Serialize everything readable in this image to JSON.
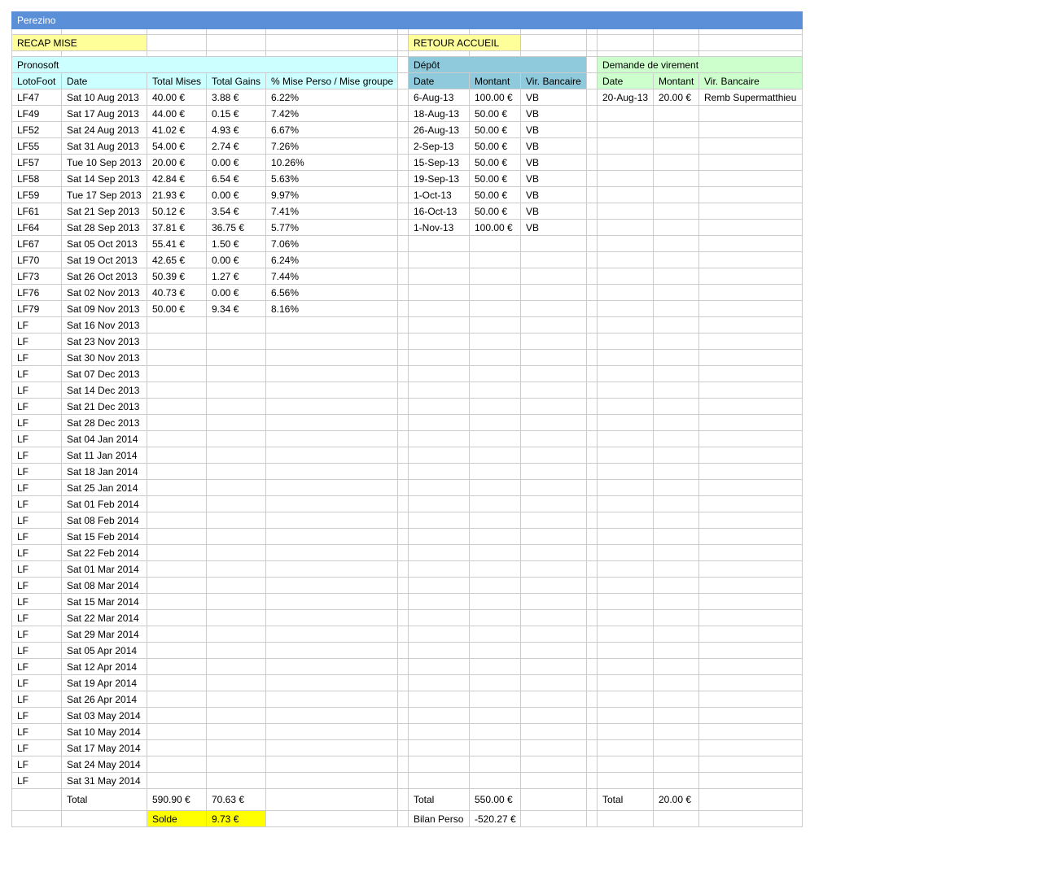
{
  "sheet": {
    "title": "Perezino",
    "recap_label": "RECAP MISE",
    "retour_label": "RETOUR ACCUEIL"
  },
  "pronosoft": {
    "title": "Pronosoft",
    "headers": [
      "LotoFoot",
      "Date",
      "Total Mises",
      "Total Gains",
      "% Mise Perso / Mise groupe"
    ],
    "rows": [
      [
        "LF47",
        "Sat 10 Aug 2013",
        "40.00 €",
        "3.88 €",
        "6.22%"
      ],
      [
        "LF49",
        "Sat 17 Aug 2013",
        "44.00 €",
        "0.15 €",
        "7.42%"
      ],
      [
        "LF52",
        "Sat 24 Aug 2013",
        "41.02 €",
        "4.93 €",
        "6.67%"
      ],
      [
        "LF55",
        "Sat 31 Aug 2013",
        "54.00 €",
        "2.74 €",
        "7.26%"
      ],
      [
        "LF57",
        "Tue 10 Sep 2013",
        "20.00 €",
        "0.00 €",
        "10.26%"
      ],
      [
        "LF58",
        "Sat 14 Sep 2013",
        "42.84 €",
        "6.54 €",
        "5.63%"
      ],
      [
        "LF59",
        "Tue 17 Sep 2013",
        "21.93 €",
        "0.00 €",
        "9.97%"
      ],
      [
        "LF61",
        "Sat 21 Sep 2013",
        "50.12 €",
        "3.54 €",
        "7.41%"
      ],
      [
        "LF64",
        "Sat 28 Sep 2013",
        "37.81 €",
        "36.75 €",
        "5.77%"
      ],
      [
        "LF67",
        "Sat 05 Oct 2013",
        "55.41 €",
        "1.50 €",
        "7.06%"
      ],
      [
        "LF70",
        "Sat 19 Oct 2013",
        "42.65 €",
        "0.00 €",
        "6.24%"
      ],
      [
        "LF73",
        "Sat 26 Oct 2013",
        "50.39 €",
        "1.27 €",
        "7.44%"
      ],
      [
        "LF76",
        "Sat 02 Nov 2013",
        "40.73 €",
        "0.00 €",
        "6.56%"
      ],
      [
        "LF79",
        "Sat 09 Nov 2013",
        "50.00 €",
        "9.34 €",
        "8.16%"
      ],
      [
        "LF",
        "Sat 16 Nov 2013"
      ],
      [
        "LF",
        "Sat 23 Nov 2013"
      ],
      [
        "LF",
        "Sat 30 Nov 2013"
      ],
      [
        "LF",
        "Sat 07 Dec 2013"
      ],
      [
        "LF",
        "Sat 14 Dec 2013"
      ],
      [
        "LF",
        "Sat 21 Dec 2013"
      ],
      [
        "LF",
        "Sat 28 Dec 2013"
      ],
      [
        "LF",
        "Sat 04 Jan 2014"
      ],
      [
        "LF",
        "Sat 11 Jan 2014"
      ],
      [
        "LF",
        "Sat 18 Jan 2014"
      ],
      [
        "LF",
        "Sat 25 Jan 2014"
      ],
      [
        "LF",
        "Sat 01 Feb 2014"
      ],
      [
        "LF",
        "Sat 08 Feb 2014"
      ],
      [
        "LF",
        "Sat 15 Feb 2014"
      ],
      [
        "LF",
        "Sat 22 Feb 2014"
      ],
      [
        "LF",
        "Sat 01 Mar 2014"
      ],
      [
        "LF",
        "Sat 08 Mar 2014"
      ],
      [
        "LF",
        "Sat 15 Mar 2014"
      ],
      [
        "LF",
        "Sat 22 Mar 2014"
      ],
      [
        "LF",
        "Sat 29 Mar 2014"
      ],
      [
        "LF",
        "Sat 05 Apr 2014"
      ],
      [
        "LF",
        "Sat 12 Apr 2014"
      ],
      [
        "LF",
        "Sat 19 Apr 2014"
      ],
      [
        "LF",
        "Sat 26 Apr 2014"
      ],
      [
        "LF",
        "Sat 03 May 2014"
      ],
      [
        "LF",
        "Sat 10 May 2014"
      ],
      [
        "LF",
        "Sat 17 May 2014"
      ],
      [
        "LF",
        "Sat 24 May 2014"
      ],
      [
        "LF",
        "Sat 31 May 2014"
      ]
    ],
    "total_label": "Total",
    "total_mises": "590.90 €",
    "total_gains": "70.63 €",
    "solde_label": "Solde",
    "solde_value": "9.73 €"
  },
  "depot": {
    "title": "Dépôt",
    "headers": [
      "Date",
      "Montant",
      "Vir. Bancaire"
    ],
    "rows": [
      [
        "6-Aug-13",
        "100.00 €",
        "VB"
      ],
      [
        "18-Aug-13",
        "50.00 €",
        "VB"
      ],
      [
        "26-Aug-13",
        "50.00 €",
        "VB"
      ],
      [
        "2-Sep-13",
        "50.00 €",
        "VB"
      ],
      [
        "15-Sep-13",
        "50.00 €",
        "VB"
      ],
      [
        "19-Sep-13",
        "50.00 €",
        "VB"
      ],
      [
        "1-Oct-13",
        "50.00 €",
        "VB"
      ],
      [
        "16-Oct-13",
        "50.00 €",
        "VB"
      ],
      [
        "1-Nov-13",
        "100.00 €",
        "VB"
      ]
    ],
    "total_label": "Total",
    "total_value": "550.00 €",
    "bilan_label": "Bilan Perso",
    "bilan_value": "-520.27 €"
  },
  "virement": {
    "title": "Demande de virement",
    "headers": [
      "Date",
      "Montant",
      "Vir. Bancaire"
    ],
    "rows": [
      [
        "20-Aug-13",
        "20.00 €",
        "Remb Supermatthieu"
      ]
    ],
    "total_label": "Total",
    "total_value": "20.00 €"
  },
  "colors": {
    "title_bar": "#5b8fd8",
    "label_yellow": "#ffff99",
    "pronosoft_header": "#ccffff",
    "depot_header": "#8ecadb",
    "virement_header": "#ccffcc",
    "solde_highlight": "#ffff00",
    "grid_line": "#cccccc"
  }
}
